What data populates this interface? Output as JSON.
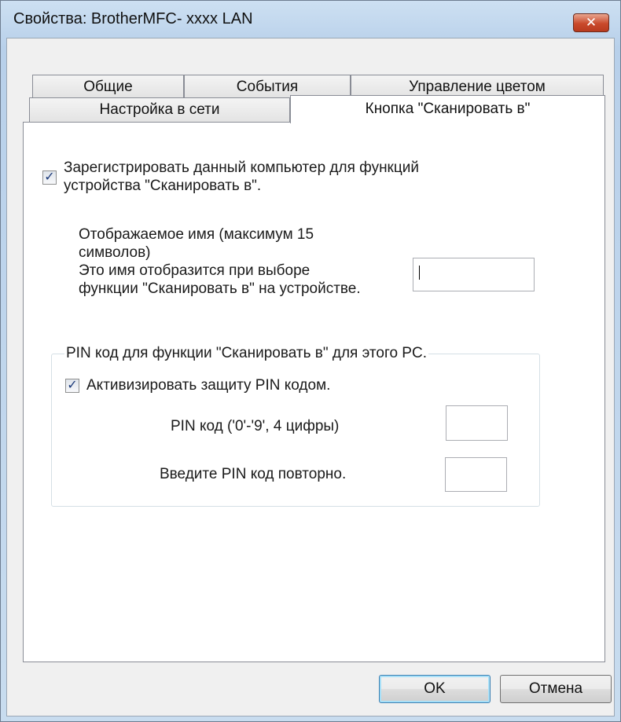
{
  "window": {
    "title": "Свойства: BrotherMFC- xxxx LAN",
    "close_symbol": "✕",
    "icons": {
      "close": "close-icon",
      "checkmark": "checkmark-icon"
    }
  },
  "tabs": {
    "row1": [
      "Общие",
      "События",
      "Управление цветом"
    ],
    "row2": [
      "Настройка в сети",
      "Кнопка \"Сканировать в\""
    ],
    "active": "Кнопка \"Сканировать в\""
  },
  "scan_to": {
    "register_line1": "Зарегистрировать данный компьютер для функций",
    "register_line2": "устройства \"Сканировать в\".",
    "register_checked": true,
    "display_name_line1": "Отображаемое имя (максимум 15",
    "display_name_line2": "символов)",
    "display_name_line3": "Это имя отобразится при выборе",
    "display_name_line4": "функции \"Сканировать в\" на устройстве.",
    "display_name_value": ""
  },
  "pin": {
    "group_title": "PIN код для функции \"Сканировать в\" для этого PC.",
    "enable_label": "Активизировать защиту PIN кодом.",
    "enable_checked": true,
    "pin_label": "PIN код ('0'-'9', 4 цифры)",
    "pin_value": "",
    "repeat_label": "Введите PIN код повторно.",
    "repeat_value": ""
  },
  "buttons": {
    "ok": "OK",
    "cancel": "Отмена"
  }
}
